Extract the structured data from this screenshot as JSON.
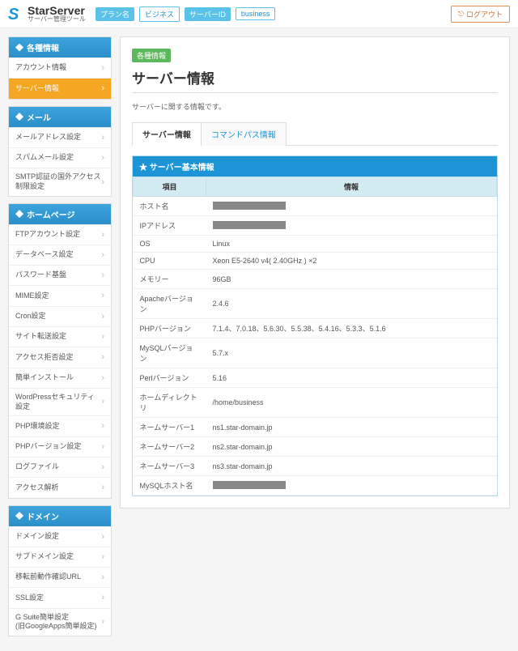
{
  "header": {
    "brand": "StarServer",
    "brand_sub": "サーバー管理ツール",
    "tags": [
      {
        "label": "プラン名",
        "value": "ビジネス"
      },
      {
        "label": "サーバーID",
        "value": "business"
      }
    ],
    "logout": "ログアウト"
  },
  "sidebar": [
    {
      "title": "各種情報",
      "items": [
        {
          "label": "アカウント情報",
          "active": false
        },
        {
          "label": "サーバー情報",
          "active": true
        }
      ]
    },
    {
      "title": "メール",
      "items": [
        {
          "label": "メールアドレス設定"
        },
        {
          "label": "スパムメール設定"
        },
        {
          "label": "SMTP認証の国外アクセス制限設定"
        }
      ]
    },
    {
      "title": "ホームページ",
      "items": [
        {
          "label": "FTPアカウント設定"
        },
        {
          "label": "データベース設定"
        },
        {
          "label": "パスワード基盤"
        },
        {
          "label": "MIME設定"
        },
        {
          "label": "Cron設定"
        },
        {
          "label": "サイト転送設定"
        },
        {
          "label": "アクセス拒否設定"
        },
        {
          "label": "簡単インストール"
        },
        {
          "label": "WordPressセキュリティ設定"
        },
        {
          "label": "PHP環境設定"
        },
        {
          "label": "PHPバージョン設定"
        },
        {
          "label": "ログファイル"
        },
        {
          "label": "アクセス解析"
        }
      ]
    },
    {
      "title": "ドメイン",
      "items": [
        {
          "label": "ドメイン設定"
        },
        {
          "label": "サブドメイン設定"
        },
        {
          "label": "移転前動作確認URL"
        },
        {
          "label": "SSL設定"
        },
        {
          "label": "G Suite簡単設定\n(旧GoogleApps簡単設定)"
        }
      ]
    }
  ],
  "main": {
    "badge": "各種情報",
    "title": "サーバー情報",
    "desc": "サーバーに関する情報です。",
    "tabs": [
      "サーバー情報",
      "コマンドパス情報"
    ],
    "panel_title": "サーバー基本情報",
    "columns": [
      "項目",
      "情報"
    ],
    "rows": [
      {
        "k": "ホスト名",
        "v": "",
        "redacted": true
      },
      {
        "k": "IPアドレス",
        "v": "",
        "redacted": true
      },
      {
        "k": "OS",
        "v": "Linux"
      },
      {
        "k": "CPU",
        "v": "Xeon E5-2640 v4( 2.40GHz ) ×2"
      },
      {
        "k": "メモリー",
        "v": "96GB"
      },
      {
        "k": "Apacheバージョン",
        "v": "2.4.6"
      },
      {
        "k": "PHPバージョン",
        "v": "7.1.4、7.0.18、5.6.30、5.5.38、5.4.16、5.3.3、5.1.6"
      },
      {
        "k": "MySQLバージョン",
        "v": "5.7.x"
      },
      {
        "k": "Perlバージョン",
        "v": "5.16"
      },
      {
        "k": "ホームディレクトリ",
        "v": "/home/business"
      },
      {
        "k": "ネームサーバー1",
        "v": "ns1.star-domain.jp"
      },
      {
        "k": "ネームサーバー2",
        "v": "ns2.star-domain.jp"
      },
      {
        "k": "ネームサーバー3",
        "v": "ns3.star-domain.jp"
      },
      {
        "k": "MySQLホスト名",
        "v": "",
        "redacted": true
      }
    ]
  }
}
